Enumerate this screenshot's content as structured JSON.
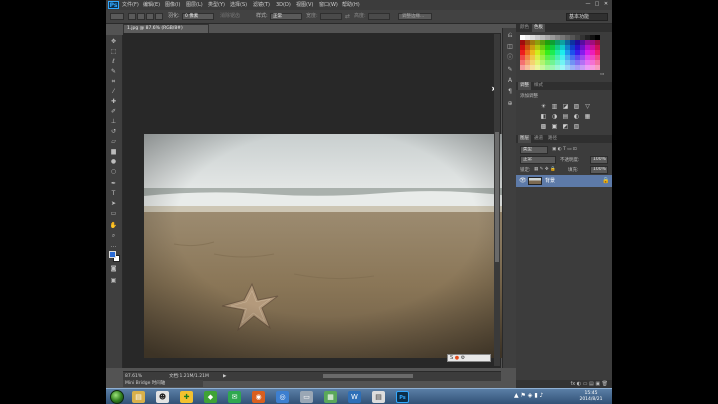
{
  "app": {
    "logo": "Ps"
  },
  "menu": [
    "文件(F)",
    "编辑(E)",
    "图像(I)",
    "图层(L)",
    "类型(Y)",
    "选择(S)",
    "滤镜(T)",
    "3D(D)",
    "视图(V)",
    "窗口(W)",
    "帮助(H)"
  ],
  "window_controls": [
    "—",
    "□",
    "✕"
  ],
  "options_bar": {
    "feather_label": "羽化:",
    "feather_value": "0 像素",
    "antialias_label": "消除锯齿",
    "style_label": "样式:",
    "style_value": "正常",
    "width_label": "宽度:",
    "height_label": "高度:",
    "refine_edge": "调整边缘...",
    "workspace": "基本功能"
  },
  "document": {
    "tab_title": "1.jpg @ 87.6% (RGB/8#)",
    "zoom": "87.61%",
    "doc_info": "文档:1.21M/1.21M",
    "bottom_tab": "Mini Bridge  时间轴"
  },
  "panels": {
    "swatches_tabs": [
      "颜色",
      "色板"
    ],
    "adjustments_tabs": [
      "调整",
      "样式"
    ],
    "adjustments_title": "添加调整",
    "adjust_icons": [
      "☀",
      "▥",
      "◪",
      "▨",
      "▽",
      "◧",
      "◑",
      "▤",
      "◐",
      "▦",
      "▩",
      "▣",
      "◩",
      "▧"
    ],
    "layers_tabs": [
      "图层",
      "通道",
      "路径"
    ],
    "kind_filter": "类型",
    "blend_mode": "正常",
    "opacity_label": "不透明度:",
    "opacity_value": "100%",
    "lock_label": "锁定:",
    "fill_label": "填充:",
    "fill_value": "100%",
    "layer_name": "背景",
    "footer_icons": "fx ◐ ▭ ▤ ▣ 🗑"
  },
  "taskbar": {
    "time": "15:45",
    "date": "2014/8/21"
  },
  "colors": {
    "foreground": "#2a6bd6",
    "background": "#ffffff",
    "selected_layer": "#5d7aa8"
  }
}
